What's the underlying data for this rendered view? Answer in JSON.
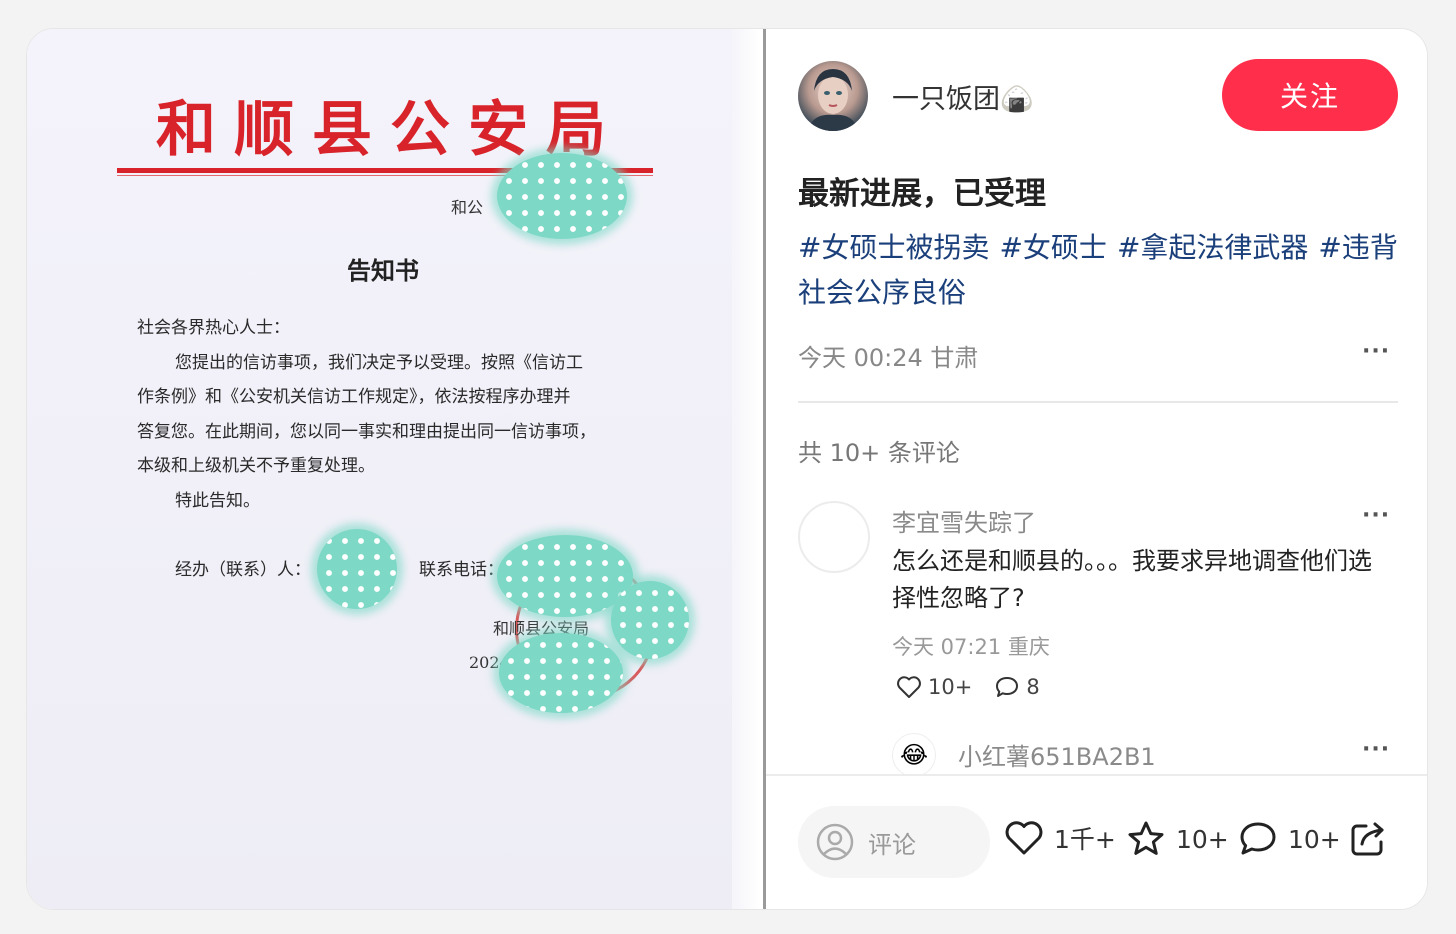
{
  "document": {
    "org_title": "和顺县公安局",
    "ref_prefix": "和公",
    "heading": "告知书",
    "salutation": "社会各界热心人士：",
    "body_lines": [
      "您提出的信访事项，我们决定予以受理。按照《信访工",
      "作条例》和《公安机关信访工作规定》，依法按程序办理并",
      "答复您。在此期间，您以同一事实和理由提出同一信访事项，",
      "本级和上级机关不予重复处理。"
    ],
    "closing": "特此告知。",
    "handler_label": "经办（联系）人：",
    "phone_label": "联系电话：",
    "signature_org": "和顺县公安局",
    "date_prefix": "2024"
  },
  "post": {
    "author": "一只饭团🍙",
    "follow_label": "关注",
    "title": "最新进展，已受理",
    "tags": [
      "#女硕士被拐卖",
      "#女硕士",
      "#拿起法律武器",
      "#违背社会公序良俗"
    ],
    "meta": "今天 00:24 甘肃",
    "more_label": "···"
  },
  "comments": {
    "count_label": "共 10+ 条评论",
    "items": [
      {
        "user": "李宜雪失踪了",
        "text": "怎么还是和顺县的。。。我要求异地调查他们选择性忽略了?",
        "meta": "今天 07:21 重庆",
        "likes": "10+",
        "replies": "8"
      }
    ],
    "reply_preview": {
      "avatar_emoji": "😂",
      "user": "小红薯651BA2B1"
    }
  },
  "bottom_bar": {
    "input_placeholder": "评论",
    "likes": "1千+",
    "favorites": "10+",
    "comments": "10+"
  },
  "colors": {
    "accent": "#ff2f4c",
    "tag": "#1a3f7a",
    "document_red": "#d8232a",
    "redaction": "#7dd8c6"
  }
}
